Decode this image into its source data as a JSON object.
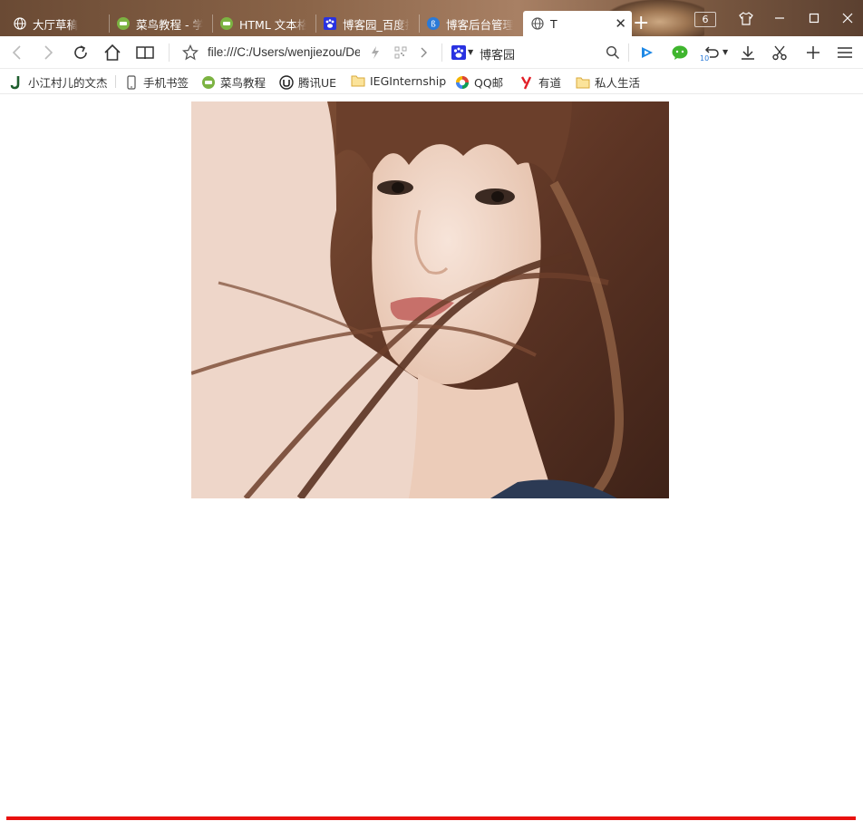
{
  "browser": {
    "tabs": [
      {
        "label": "大厅草稿",
        "icon": "globe-icon"
      },
      {
        "label": "菜鸟教程 - 学",
        "icon": "runoob-icon"
      },
      {
        "label": "HTML 文本格",
        "icon": "runoob-icon"
      },
      {
        "label": "博客园_百度搜",
        "icon": "baidu-paw-icon"
      },
      {
        "label": "博客后台管理",
        "icon": "cnblogs-icon"
      },
      {
        "label": "T",
        "icon": "globe-icon",
        "active": true
      }
    ],
    "tab_count": "6",
    "address": "file:///C:/Users/wenjiezou/Desktop",
    "search_engine_label": "博客园",
    "undo_count": "10"
  },
  "bookmarks": [
    {
      "label": "小江村儿的文杰",
      "icon": "j-logo-icon"
    },
    {
      "label": "手机书签",
      "icon": "phone-icon"
    },
    {
      "label": "菜鸟教程",
      "icon": "runoob-icon"
    },
    {
      "label": "腾讯UE",
      "icon": "ue-logo-icon"
    },
    {
      "label": "IEGInternship",
      "icon": "folder-icon"
    },
    {
      "label": "QQ邮",
      "icon": "qqmail-icon"
    },
    {
      "label": "有道",
      "icon": "youdao-icon"
    },
    {
      "label": "私人生活",
      "icon": "folder-icon"
    }
  ],
  "page": {
    "image_subject": "portrait photo of a woman with long brown windswept hair",
    "rule_color": "#e8110f"
  },
  "colors": {
    "accent_blue": "#2a7ad8",
    "wechat_green": "#3fb52e",
    "runoob_green": "#7cb342",
    "folder_yellow": "#f3c34e"
  }
}
